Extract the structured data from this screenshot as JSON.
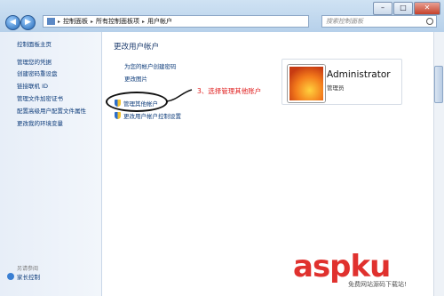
{
  "window": {
    "minimize": "–",
    "maximize": "□",
    "close": "✕"
  },
  "address": {
    "crumbs": [
      "控制面板",
      "所有控制面板项",
      "用户帐户"
    ],
    "search_placeholder": "搜索控制面板"
  },
  "sidebar": {
    "items": [
      "控制面板主页",
      "管理您的凭据",
      "创建密码重设盘",
      "链接联机 ID",
      "管理文件加密证书",
      "配置高级用户配置文件属性",
      "更改我的环境变量"
    ],
    "see_also": "另请参阅",
    "family": "家长控制"
  },
  "main": {
    "title": "更改用户帐户",
    "links": [
      "为您的帐户创建密码",
      "更改图片"
    ],
    "shield_links": [
      "管理其他帐户",
      "更改用户帐户控制设置"
    ]
  },
  "user": {
    "name": "Administrator",
    "role": "管理员"
  },
  "annotation": "3、选择管理其他账户",
  "watermark": {
    "brand": "aspku",
    "site": "免费网站源码下载站!"
  },
  "colors": {
    "link": "#0c3b7a",
    "annotation": "#e02020",
    "accent": "#1f64b4"
  }
}
